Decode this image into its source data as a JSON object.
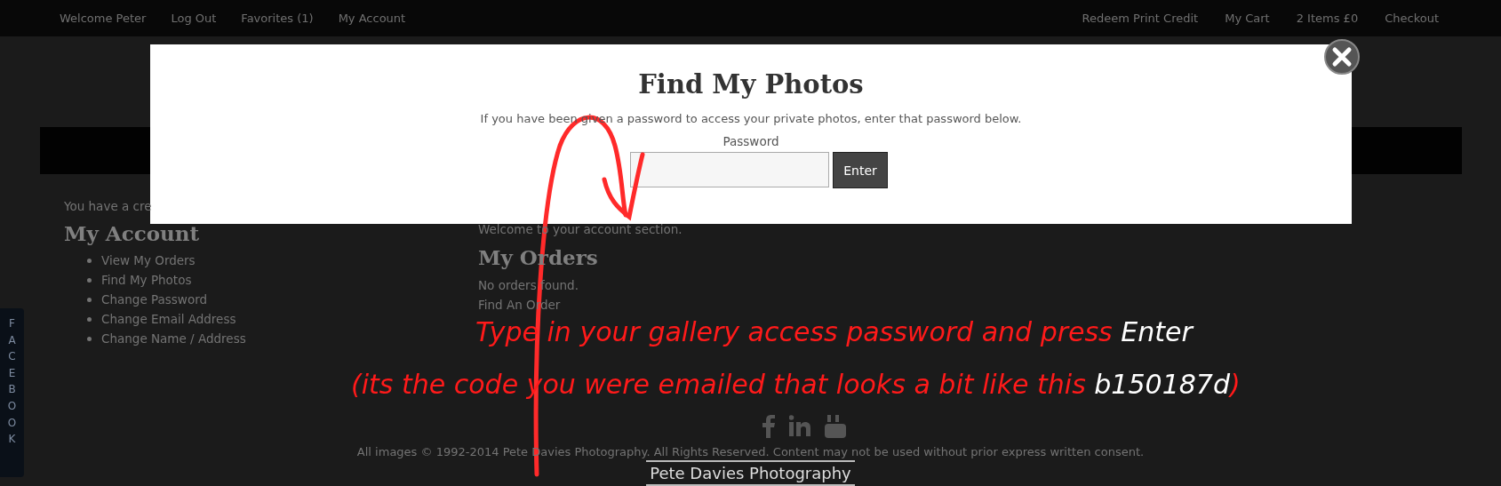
{
  "top_nav": {
    "left": [
      "Welcome Peter",
      "Log Out",
      "Favorites (1)",
      "My Account"
    ],
    "right": [
      "Redeem Print Credit",
      "My Cart",
      "2 Items £0",
      "Checkout"
    ]
  },
  "account_menu": {
    "notice": "You have a cre",
    "title": "My Account",
    "items": [
      "View My Orders",
      "Find My Photos",
      "Change Password",
      "Change Email Address",
      "Change Name / Address"
    ]
  },
  "main": {
    "welcome": "Welcome to your account section.",
    "title": "My Orders",
    "empty": "No orders found.",
    "link": "Find An Order"
  },
  "facebook_tab": "FACEBOOK",
  "footer": {
    "copyright": "All images © 1992-2014 Pete Davies Photography. All Rights Reserved. Content may not be used without prior express written consent.",
    "brand": "Pete Davies Photography"
  },
  "modal": {
    "title": "Find My Photos",
    "description": "If you have been given a password to access your private photos, enter that password below.",
    "password_label": "Password",
    "button": "Enter"
  },
  "annotation": {
    "line_1": "Type in your gallery access password and press",
    "key": "Enter",
    "line_2": "(its the code you were emailed that looks a bit like this",
    "code": "b150187d",
    "line_2_end": ")"
  }
}
